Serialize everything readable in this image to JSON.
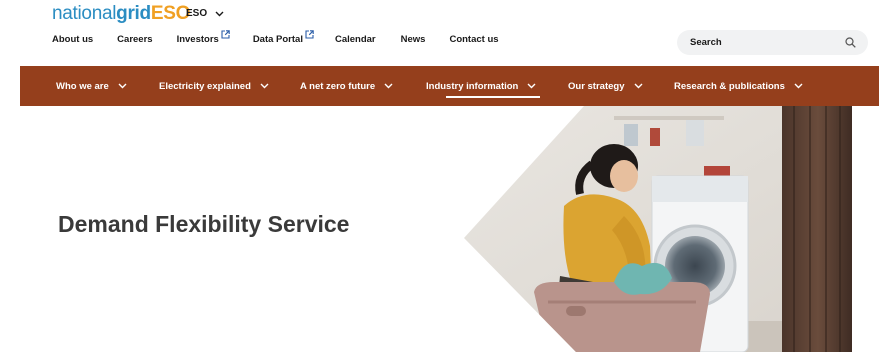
{
  "logo": {
    "part1": "national",
    "part2": "grid",
    "part3": "ESO"
  },
  "site_switcher": {
    "label": "ESO",
    "icon": "chevron-down-icon"
  },
  "utility_nav": [
    {
      "label": "About us",
      "external": false
    },
    {
      "label": "Careers",
      "external": false
    },
    {
      "label": "Investors",
      "external": true
    },
    {
      "label": "Data Portal",
      "external": true
    },
    {
      "label": "Calendar",
      "external": false
    },
    {
      "label": "News",
      "external": false
    },
    {
      "label": "Contact us",
      "external": false
    }
  ],
  "search": {
    "placeholder": "Search",
    "icon": "search-icon"
  },
  "main_nav": {
    "background": "#953f1c",
    "items": [
      {
        "label": "Who we are",
        "active": false
      },
      {
        "label": "Electricity explained",
        "active": false
      },
      {
        "label": "A net zero future",
        "active": false
      },
      {
        "label": "Industry information",
        "active": true
      },
      {
        "label": "Our strategy",
        "active": false
      },
      {
        "label": "Research & publications",
        "active": false
      }
    ]
  },
  "hero": {
    "title": "Demand Flexibility Service",
    "image": "girl-loading-washing-machine-photo"
  },
  "colors": {
    "brand_blue": "#2b8dc2",
    "brand_orange": "#f0a023",
    "nav_brown": "#953f1c",
    "title_gray": "#3a3a3a"
  }
}
